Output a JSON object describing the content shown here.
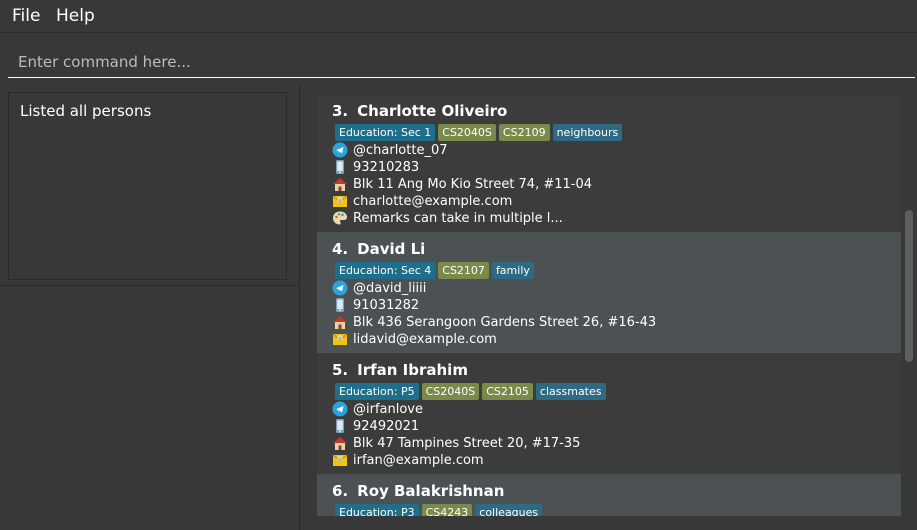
{
  "menu": {
    "file": "File",
    "help": "Help"
  },
  "command": {
    "placeholder": "Enter command here..."
  },
  "result": {
    "text": "Listed all persons"
  },
  "colors": {
    "education_tag": "#1e6f8c",
    "module_tag": "#7a8a4a",
    "group_tag": "#2f6a85",
    "selected_card": "#4c5254"
  },
  "persons": [
    {
      "index": "3.",
      "name": "Charlotte Oliveiro",
      "education": "Education: Sec 1",
      "modules": [
        "CS2040S",
        "CS2109"
      ],
      "groups": [
        "neighbours"
      ],
      "telegram": "@charlotte_07",
      "phone": "93210283",
      "address": "Blk 11 Ang Mo Kio Street 74, #11-04",
      "email": "charlotte@example.com",
      "remark": "Remarks can take in multiple l..."
    },
    {
      "index": "4.",
      "name": "David Li",
      "education": "Education: Sec 4",
      "modules": [
        "CS2107"
      ],
      "groups": [
        "family"
      ],
      "telegram": "@david_liiii",
      "phone": "91031282",
      "address": "Blk 436 Serangoon Gardens Street 26, #16-43",
      "email": "lidavid@example.com"
    },
    {
      "index": "5.",
      "name": "Irfan Ibrahim",
      "education": "Education: P5",
      "modules": [
        "CS2040S",
        "CS2105"
      ],
      "groups": [
        "classmates"
      ],
      "telegram": "@irfanlove",
      "phone": "92492021",
      "address": "Blk 47 Tampines Street 20, #17-35",
      "email": "irfan@example.com"
    },
    {
      "index": "6.",
      "name": "Roy Balakrishnan",
      "education": "Education: P3",
      "modules": [
        "CS4243"
      ],
      "groups": [
        "colleagues"
      ]
    }
  ]
}
